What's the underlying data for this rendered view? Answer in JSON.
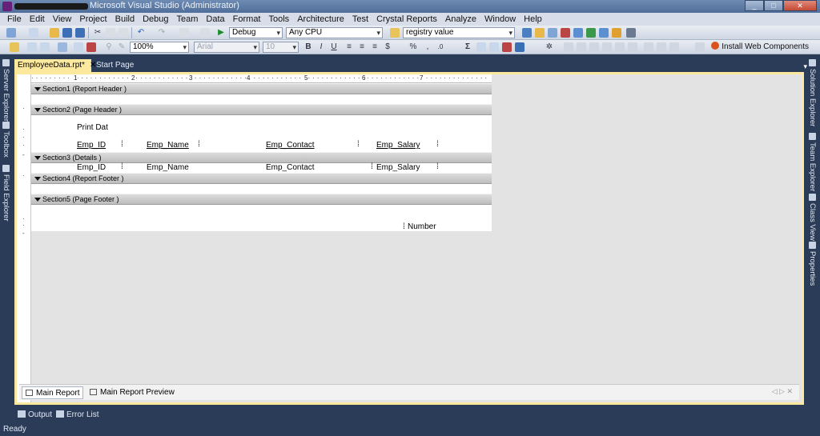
{
  "window": {
    "title": "Microsoft Visual Studio (Administrator)",
    "min": "_",
    "max": "□",
    "close": "✕"
  },
  "menu": [
    "File",
    "Edit",
    "View",
    "Project",
    "Build",
    "Debug",
    "Team",
    "Data",
    "Format",
    "Tools",
    "Architecture",
    "Test",
    "Crystal Reports",
    "Analyze",
    "Window",
    "Help"
  ],
  "toolbar1": {
    "configuration": "Debug",
    "platform": "Any CPU",
    "search": "registry value"
  },
  "toolbar2": {
    "zoom": "100%",
    "font": "Arial",
    "font_size": "10",
    "bold": "B",
    "italic": "I",
    "underline": "U",
    "currency": "$",
    "percent": "%",
    "install": "Install Web Components"
  },
  "left_panes": [
    "Server Explorer",
    "Toolbox",
    "Field Explorer"
  ],
  "right_panes": [
    "Solution Explorer",
    "Team Explorer",
    "Class View",
    "Properties"
  ],
  "tabs": {
    "active": "EmployeeData.rpt*",
    "close": "✕",
    "other": "Start Page"
  },
  "ruler": {
    "h_marks": [
      "1",
      "2",
      "3",
      "4",
      "5",
      "6",
      "7"
    ]
  },
  "sections": [
    {
      "label": "Section1 (Report Header )"
    },
    {
      "label": "Section2 (Page Header )"
    },
    {
      "label": "Section3 (Details )"
    },
    {
      "label": "Section4 (Report Footer )"
    },
    {
      "label": "Section5 (Page Footer )"
    }
  ],
  "page_header": {
    "print_date": "Print Dat",
    "columns": [
      "Emp_ID",
      "Emp_Name",
      "Emp_Contact",
      "Emp_Salary"
    ]
  },
  "details": {
    "fields": [
      "Emp_ID",
      "Emp_Name",
      "Emp_Contact",
      "Emp_Salary"
    ]
  },
  "page_footer": {
    "page_number": "Number"
  },
  "view_tabs": [
    "Main Report",
    "Main Report Preview"
  ],
  "output_tabs": [
    "Output",
    "Error List"
  ],
  "status": "Ready",
  "colors": {
    "chrome": "#2b3c59",
    "doc_tab": "#fde99e",
    "canvas": "#e3e3e3"
  }
}
